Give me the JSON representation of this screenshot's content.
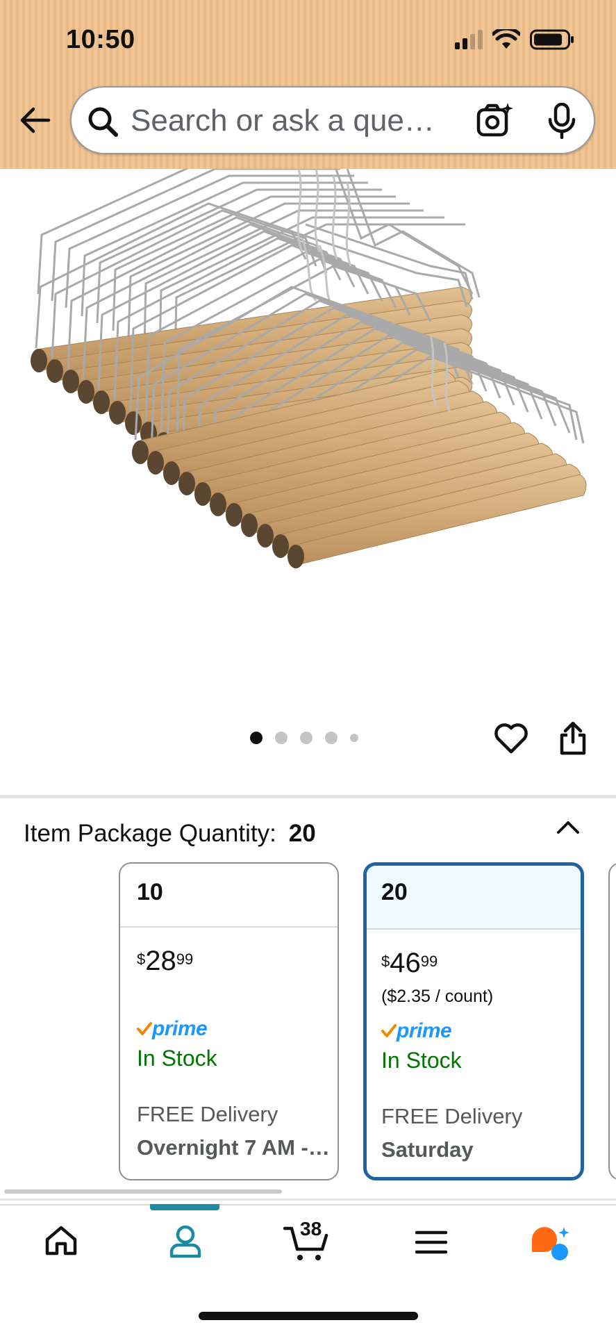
{
  "status_bar": {
    "time": "10:50"
  },
  "search": {
    "placeholder": "Search or ask a que…"
  },
  "carousel": {
    "total_dots": 5,
    "active_index": 0
  },
  "quantity": {
    "label": "Item Package Quantity:",
    "selected": "20"
  },
  "options": [
    {
      "qty": "10",
      "price_symbol": "$",
      "price_whole": "28",
      "price_cents": "99",
      "per_count": "",
      "prime_label": "prime",
      "stock": "In Stock",
      "delivery_label": "FREE Delivery",
      "delivery_date": "Overnight 7 AM - …",
      "selected": false
    },
    {
      "qty": "20",
      "price_symbol": "$",
      "price_whole": "46",
      "price_cents": "99",
      "per_count": "($2.35 / count)",
      "prime_label": "prime",
      "stock": "In Stock",
      "delivery_label": "FREE Delivery",
      "delivery_date": "Saturday",
      "selected": true
    }
  ],
  "nav": {
    "cart_count": "38",
    "active": "account"
  },
  "colors": {
    "header_bg": "#f0c595",
    "selected_border": "#2162a1",
    "selected_head_bg": "#edf8ff",
    "in_stock": "#007600",
    "prime_blue": "#1a98ff",
    "prime_check": "#f08804",
    "nav_active": "#1c8aa0",
    "rufus_orange": "#ff6a13",
    "rufus_blue": "#1a98ff"
  }
}
